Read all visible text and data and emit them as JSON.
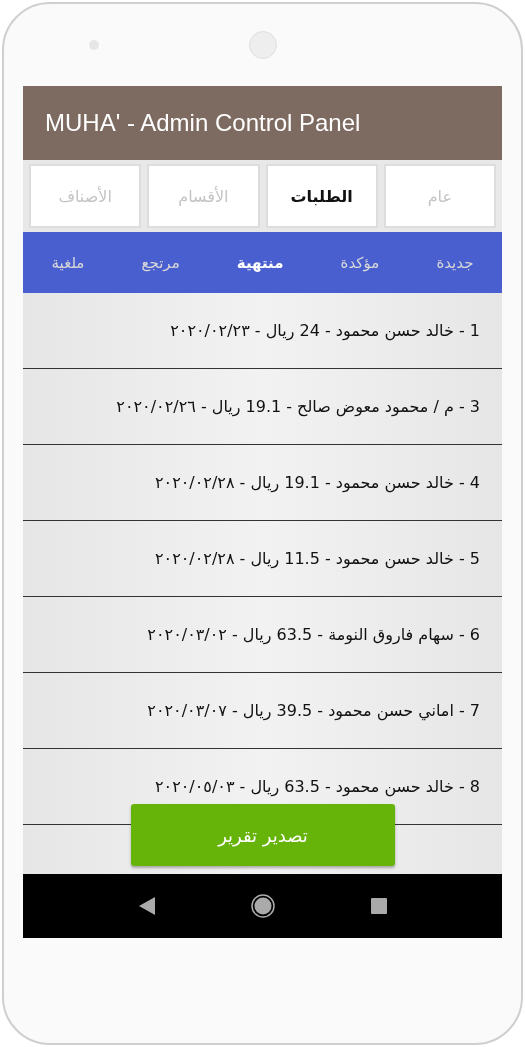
{
  "app_bar": {
    "title": "MUHA' - Admin Control Panel"
  },
  "tabs": [
    {
      "label": "عام",
      "selected": false
    },
    {
      "label": "الطلبات",
      "selected": true
    },
    {
      "label": "الأقسام",
      "selected": false
    },
    {
      "label": "الأصناف",
      "selected": false
    }
  ],
  "status_tabs": [
    {
      "label": "جديدة",
      "selected": false
    },
    {
      "label": "مؤكدة",
      "selected": false
    },
    {
      "label": "منتهية",
      "selected": true
    },
    {
      "label": "مرتجع",
      "selected": false
    },
    {
      "label": "ملغية",
      "selected": false
    }
  ],
  "orders": [
    "1 - خالد حسن محمود - 24 ريال - ٢٠٢٠/٠٢/٢٣",
    "3 - م / محمود معوض صالح - 19.1 ريال - ٢٠٢٠/٠٢/٢٦",
    "4 - خالد حسن محمود - 19.1 ريال - ٢٠٢٠/٠٢/٢٨",
    "5 - خالد حسن محمود - 11.5 ريال - ٢٠٢٠/٠٢/٢٨",
    "6 - سهام فاروق النومة - 63.5 ريال - ٢٠٢٠/٠٣/٠٢",
    "7 - اماني حسن محمود - 39.5 ريال - ٢٠٢٠/٠٣/٠٧",
    "8 - خالد حسن محمود - 63.5 ريال - ٢٠٢٠/٠٥/٠٣"
  ],
  "export_button": "تصدير تقرير"
}
